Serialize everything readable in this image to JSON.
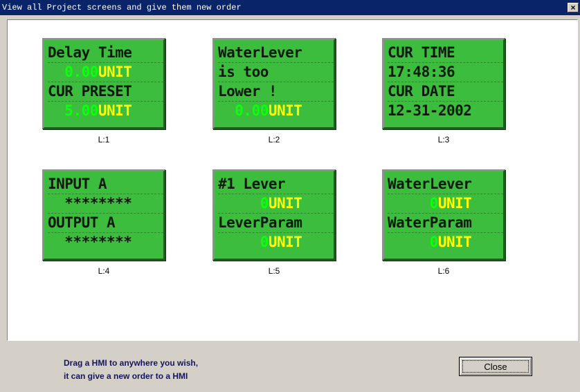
{
  "window": {
    "title": "View all Project screens and give them new order",
    "close_glyph": "×"
  },
  "screens": [
    {
      "order_label": "L:1",
      "lines": [
        {
          "text": "Delay Time"
        },
        {
          "value": "  0.00",
          "unit": "UNIT"
        },
        {
          "text": "CUR PRESET"
        },
        {
          "value": "  5.00",
          "unit": "UNIT"
        }
      ]
    },
    {
      "order_label": "L:2",
      "lines": [
        {
          "text": "WaterLever"
        },
        {
          "text": "is too"
        },
        {
          "text": "Lower !"
        },
        {
          "value": "  0.00",
          "unit": "UNIT"
        }
      ]
    },
    {
      "order_label": "L:3",
      "lines": [
        {
          "text": "CUR TIME"
        },
        {
          "text": "17:48:36"
        },
        {
          "text": "CUR DATE"
        },
        {
          "text": "12-31-2002"
        }
      ]
    },
    {
      "order_label": "L:4",
      "lines": [
        {
          "text": "INPUT A"
        },
        {
          "stars": "  ********"
        },
        {
          "text": "OUTPUT A"
        },
        {
          "stars": "  ********"
        }
      ]
    },
    {
      "order_label": "L:5",
      "lines": [
        {
          "text": "#1 Lever"
        },
        {
          "value": "     0",
          "unit": "UNIT"
        },
        {
          "text": "LeverParam"
        },
        {
          "value": "     0",
          "unit": "UNIT"
        }
      ]
    },
    {
      "order_label": "L:6",
      "lines": [
        {
          "text": "WaterLever"
        },
        {
          "value": "     0",
          "unit": "UNIT"
        },
        {
          "text": "WaterParam"
        },
        {
          "value": "     0",
          "unit": "UNIT"
        }
      ]
    }
  ],
  "footer": {
    "hint_line1": "Drag a HMI to anywhere  you wish,",
    "hint_line2": "it can give a new order to a HMI",
    "close_label": "Close"
  },
  "colors": {
    "lcd_bg": "#3dbd3d",
    "lcd_value": "#0cff0c",
    "lcd_unit": "#ffff00",
    "title_bar": "#0a246a"
  }
}
